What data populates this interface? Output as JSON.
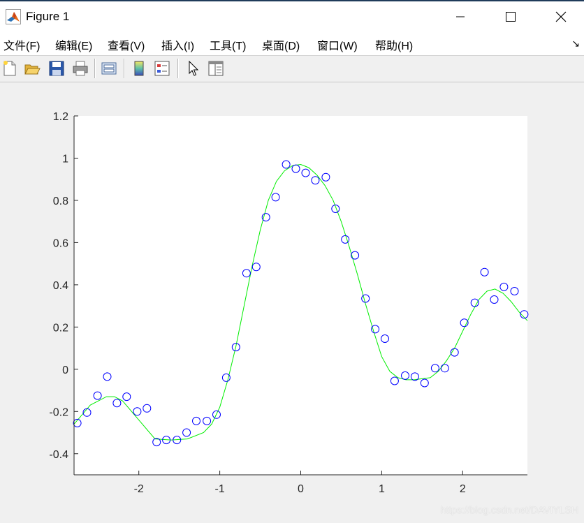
{
  "window": {
    "title": "Figure 1"
  },
  "menu": {
    "items": [
      "文件(F)",
      "编辑(E)",
      "查看(V)",
      "插入(I)",
      "工具(T)",
      "桌面(D)",
      "窗口(W)",
      "帮助(H)"
    ],
    "overflow_arrow": "↘"
  },
  "toolbar": {
    "buttons": [
      "new-figure-icon",
      "open-file-icon",
      "save-icon",
      "print-icon",
      "link-plot-icon",
      "insert-colorbar-icon",
      "insert-legend-icon",
      "edit-plot-icon",
      "property-inspector-icon"
    ]
  },
  "colors": {
    "points": "#0000ff",
    "curve": "#00ee00",
    "axes_bg": "#ffffff",
    "figure_bg": "#f0f0f0"
  },
  "chart_data": {
    "type": "scatter",
    "xlim": [
      -2.8,
      2.8
    ],
    "ylim": [
      -0.5,
      1.2
    ],
    "xticks": [
      -2,
      -1,
      0,
      1,
      2
    ],
    "yticks": [
      -0.4,
      -0.2,
      0,
      0.2,
      0.4,
      0.6,
      0.8,
      1,
      1.2
    ],
    "ytick_labels": [
      "-0.4",
      "-0.2",
      "0",
      "0.2",
      "0.4",
      "0.6",
      "0.8",
      "1",
      "1.2"
    ],
    "grid": false,
    "series": [
      {
        "type": "scatter",
        "marker": "circle",
        "x": [
          -2.76,
          -2.64,
          -2.51,
          -2.39,
          -2.27,
          -2.15,
          -2.02,
          -1.9,
          -1.78,
          -1.66,
          -1.53,
          -1.41,
          -1.29,
          -1.16,
          -1.04,
          -0.92,
          -0.8,
          -0.67,
          -0.55,
          -0.43,
          -0.31,
          -0.18,
          -0.06,
          0.06,
          0.18,
          0.31,
          0.43,
          0.55,
          0.67,
          0.8,
          0.92,
          1.04,
          1.16,
          1.29,
          1.41,
          1.53,
          1.66,
          1.78,
          1.9,
          2.02,
          2.15,
          2.27,
          2.39,
          2.51,
          2.64,
          2.76
        ],
        "y": [
          -0.255,
          -0.205,
          -0.125,
          -0.035,
          -0.16,
          -0.13,
          -0.2,
          -0.185,
          -0.345,
          -0.335,
          -0.335,
          -0.3,
          -0.245,
          -0.245,
          -0.215,
          -0.04,
          0.105,
          0.455,
          0.485,
          0.72,
          0.815,
          0.97,
          0.95,
          0.93,
          0.895,
          0.91,
          0.76,
          0.615,
          0.54,
          0.335,
          0.19,
          0.145,
          -0.055,
          -0.03,
          -0.035,
          -0.065,
          0.005,
          0.005,
          0.08,
          0.22,
          0.315,
          0.46,
          0.33,
          0.39,
          0.37,
          0.26
        ]
      },
      {
        "type": "line",
        "x": [
          -2.8,
          -2.6,
          -2.4,
          -2.3,
          -2.2,
          -2.0,
          -1.8,
          -1.6,
          -1.4,
          -1.2,
          -1.1,
          -1.0,
          -0.9,
          -0.8,
          -0.7,
          -0.6,
          -0.5,
          -0.4,
          -0.3,
          -0.2,
          -0.1,
          0.0,
          0.1,
          0.2,
          0.3,
          0.4,
          0.5,
          0.6,
          0.7,
          0.8,
          0.9,
          1.0,
          1.1,
          1.2,
          1.3,
          1.4,
          1.5,
          1.6,
          1.7,
          1.8,
          1.9,
          2.0,
          2.1,
          2.2,
          2.3,
          2.4,
          2.5,
          2.6,
          2.7,
          2.8
        ],
        "y": [
          -0.26,
          -0.17,
          -0.13,
          -0.13,
          -0.15,
          -0.24,
          -0.33,
          -0.335,
          -0.33,
          -0.3,
          -0.26,
          -0.18,
          -0.05,
          0.11,
          0.3,
          0.49,
          0.66,
          0.8,
          0.89,
          0.94,
          0.965,
          0.97,
          0.955,
          0.92,
          0.87,
          0.8,
          0.7,
          0.58,
          0.45,
          0.31,
          0.18,
          0.06,
          -0.01,
          -0.04,
          -0.05,
          -0.05,
          -0.045,
          -0.04,
          -0.01,
          0.04,
          0.1,
          0.18,
          0.26,
          0.33,
          0.37,
          0.38,
          0.36,
          0.32,
          0.27,
          0.23
        ]
      }
    ]
  },
  "watermark": "https://blog.csdn.net/DAVIYLSH"
}
